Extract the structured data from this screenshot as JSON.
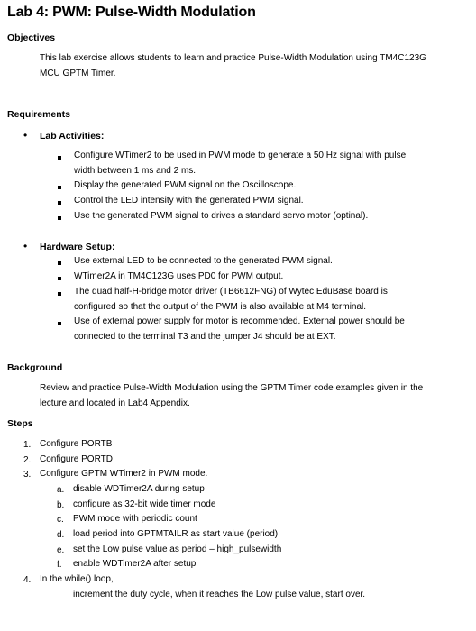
{
  "title": "Lab 4: PWM: Pulse-Width Modulation",
  "objectives": {
    "heading": "Objectives",
    "lines": [
      "This lab exercise allows students to learn and practice Pulse-Width Modulation using TM4C123G",
      "MCU GPTM Timer."
    ]
  },
  "requirements": {
    "heading": "Requirements",
    "lab_activities": {
      "label": "Lab Activities:",
      "items": [
        [
          "Configure WTimer2 to be used in PWM mode to generate a 50 Hz signal with pulse",
          "width between 1 ms and 2 ms."
        ],
        [
          "Display the generated PWM signal on the Oscilloscope."
        ],
        [
          "Control the LED intensity with the generated PWM signal."
        ],
        [
          "Use the generated PWM signal to drives a standard servo motor (optinal)."
        ]
      ]
    },
    "hardware_setup": {
      "label": "Hardware Setup:",
      "items": [
        [
          "Use external LED to be connected to the generated PWM signal."
        ],
        [
          "WTimer2A in TM4C123G uses PD0 for PWM output."
        ],
        [
          "The quad half-H-bridge motor driver (TB6612FNG) of Wytec EduBase board is",
          "configured so that the output of the PWM is also available at M4 terminal."
        ],
        [
          "Use of external power supply for motor is recommended.  External power should be",
          "connected to the terminal T3 and the jumper J4 should be at EXT."
        ]
      ]
    }
  },
  "background": {
    "heading": "Background",
    "lines": [
      "Review and practice Pulse-Width Modulation using the GPTM Timer code examples given in the",
      "lecture and located in Lab4 Appendix."
    ]
  },
  "steps": {
    "heading": "Steps",
    "items": [
      {
        "num": "1.",
        "text": "Configure PORTB"
      },
      {
        "num": "2.",
        "text": "Configure PORTD"
      },
      {
        "num": "3.",
        "text": "Configure GPTM WTimer2 in PWM mode."
      },
      {
        "num": "4.",
        "text": "In the while() loop,"
      }
    ],
    "substeps": [
      {
        "num": "a.",
        "text": "disable WDTimer2A during setup"
      },
      {
        "num": "b.",
        "text": "configure as 32-bit wide timer mode"
      },
      {
        "num": "c.",
        "text": "PWM mode with periodic count"
      },
      {
        "num": "d.",
        "text": "load period into GPTMTAILR as start value (period)"
      },
      {
        "num": "e.",
        "text": "set the Low pulse value as period – high_pulsewidth"
      },
      {
        "num": "f.",
        "text": "enable WDTimer2A after setup"
      }
    ],
    "step4_detail": "increment the duty cycle, when it reaches the Low pulse value, start over."
  }
}
